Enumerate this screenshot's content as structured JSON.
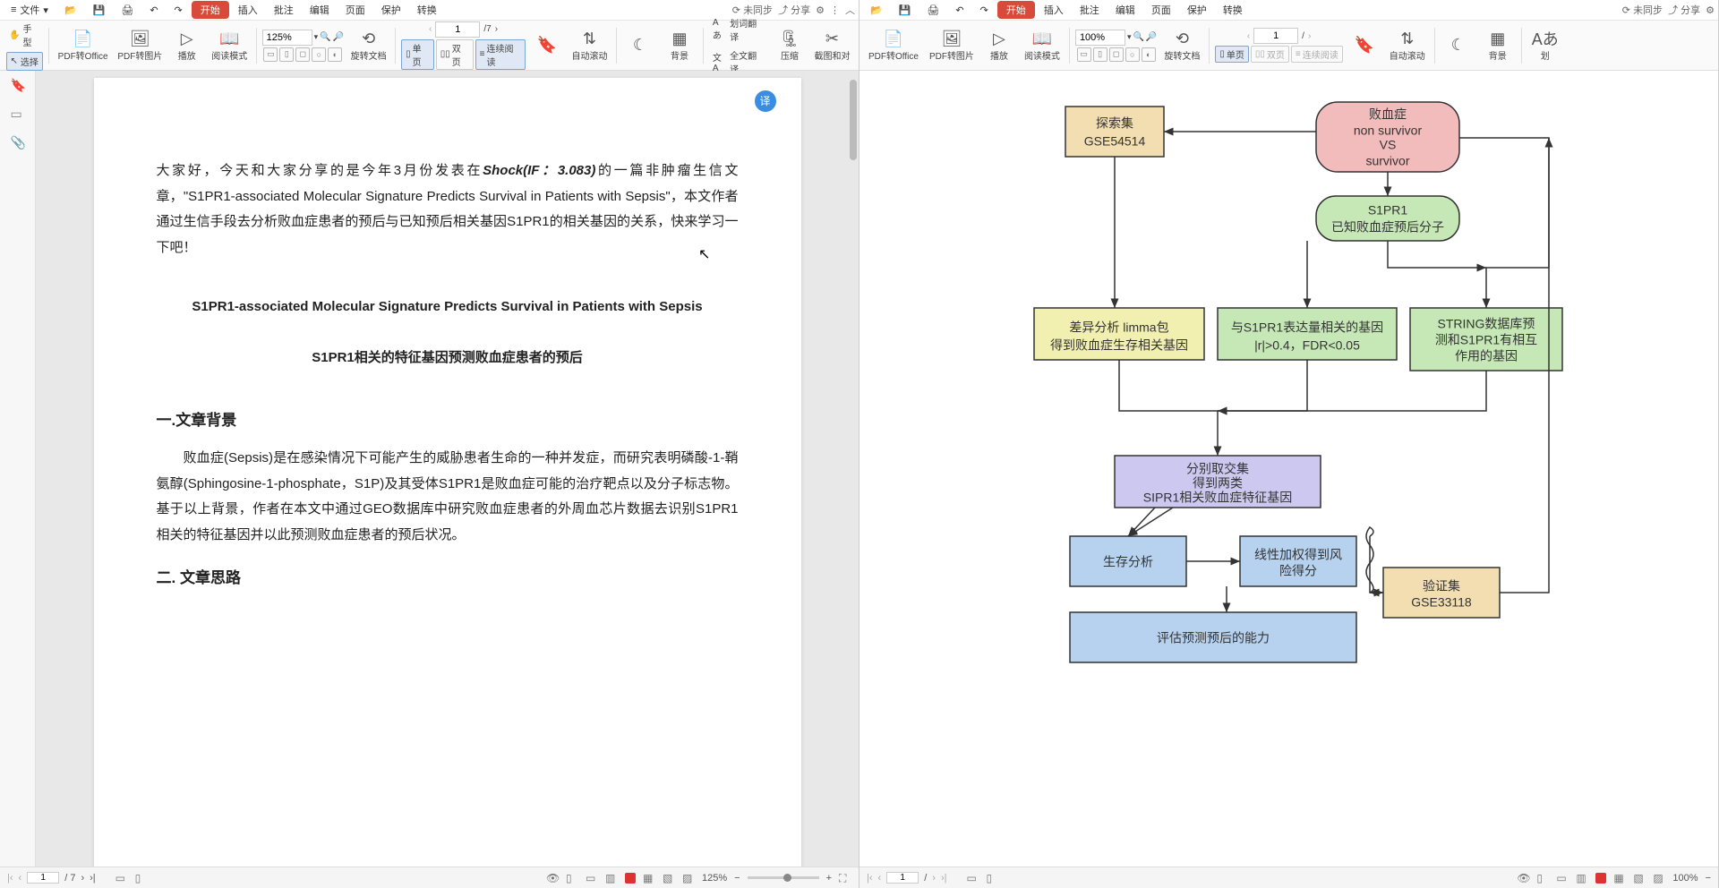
{
  "menu": {
    "file": "文件",
    "start": "开始",
    "insert": "插入",
    "comment": "批注",
    "edit": "编辑",
    "page": "页面",
    "protect": "保护",
    "convert": "转换",
    "unsync": "未同步",
    "share": "分享"
  },
  "tool": {
    "hand": "手型",
    "select": "选择",
    "pdf2office": "PDF转Office",
    "pdf2img": "PDF转图片",
    "play": "播放",
    "readmode": "阅读模式",
    "rotate": "旋转文档",
    "single": "单页",
    "double": "双页",
    "contread": "连续阅读",
    "autoscroll": "自动滚动",
    "background": "背景",
    "dict": "划词翻译",
    "fulltrans": "全文翻译",
    "compress": "压缩",
    "snap": "截图和对",
    "snap2": "划"
  },
  "left": {
    "zoom": "125%",
    "page_cur": "1",
    "page_total": "/7"
  },
  "right": {
    "zoom": "100%",
    "page_cur": "1",
    "page_total": "/"
  },
  "doc": {
    "p1a": "大家好，今天和大家分享的是今年3月份发表在",
    "p1j": "Shock(IF：3.083)",
    "p1b": "的一篇非肿瘤生信文章，\"S1PR1-associated Molecular Signature Predicts Survival in Patients with Sepsis\"，本文作者通过生信手段去分析败血症患者的预后与已知预后相关基因S1PR1的相关基因的关系，快来学习一下吧！",
    "title_en": "S1PR1-associated Molecular Signature Predicts Survival in Patients with Sepsis",
    "title_cn": "S1PR1相关的特征基因预测败血症患者的预后",
    "h1": "一.文章背景",
    "body1": "败血症(Sepsis)是在感染情况下可能产生的威胁患者生命的一种并发症，而研究表明磷酸-1-鞘氨醇(Sphingosine-1-phosphate，S1P)及其受体S1PR1是败血症可能的治疗靶点以及分子标志物。基于以上背景，作者在本文中通过GEO数据库中研究败血症患者的外周血芯片数据去识别S1PR1相关的特征基因并以此预测败血症患者的预后状况。",
    "h2": "二. 文章思路"
  },
  "flow": {
    "n1": "探索集",
    "n1b": "GSE54514",
    "n2a": "败血症",
    "n2b": "non survivor",
    "n2c": "VS",
    "n2d": "survivor",
    "n3a": "S1PR1",
    "n3b": "已知败血症预后分子",
    "n4a": "差异分析 limma包",
    "n4b": "得到败血症生存相关基因",
    "n5a": "与S1PR1表达量相关的基因",
    "n5b": "|r|>0.4，FDR<0.05",
    "n6a": "STRING数据库预",
    "n6b": "测和S1PR1有相互",
    "n6c": "作用的基因",
    "n7a": "分别取交集",
    "n7b": "得到两类",
    "n7c": "SIPR1相关败血症特征基因",
    "n8": "生存分析",
    "n9a": "线性加权得到风",
    "n9b": "险得分",
    "n10a": "验证集",
    "n10b": "GSE33118",
    "n11": "评估预测预后的能力"
  },
  "status": {
    "page_l": "1",
    "total_l": "/ 7",
    "zoom_l": "125%",
    "page_r": "1",
    "total_r": "/",
    "zoom_r": "100%"
  }
}
